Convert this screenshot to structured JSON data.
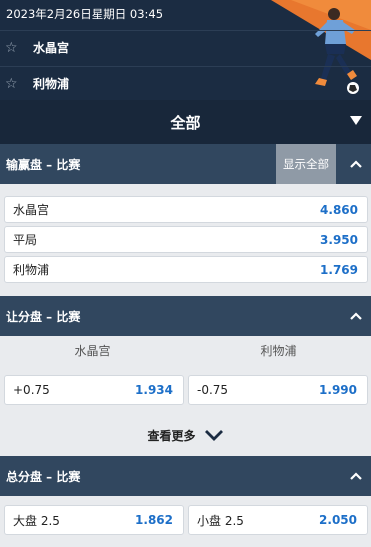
{
  "header": {
    "datetime": "2023年2月26日星期日 03:45",
    "teams": [
      {
        "name": "水晶宫",
        "star_icon": "star-outline-icon"
      },
      {
        "name": "利物浦",
        "star_icon": "star-outline-icon"
      }
    ],
    "art": "soccer-player-illustration"
  },
  "filter": {
    "label": "全部",
    "icon": "caret-down-icon"
  },
  "moneyline": {
    "title": "输赢盘 – 比赛",
    "show_all": "显示全部",
    "rows": [
      {
        "label": "水晶宫",
        "odds": "4.860"
      },
      {
        "label": "平局",
        "odds": "3.950"
      },
      {
        "label": "利物浦",
        "odds": "1.769"
      }
    ]
  },
  "handicap": {
    "title": "让分盘 – 比赛",
    "columns": [
      "水晶宫",
      "利物浦"
    ],
    "cells": [
      {
        "label": "+0.75",
        "odds": "1.934"
      },
      {
        "label": "-0.75",
        "odds": "1.990"
      }
    ],
    "more": "查看更多"
  },
  "totals": {
    "title": "总分盘 – 比赛",
    "cells": [
      {
        "label": "大盘 2.5",
        "odds": "1.862"
      },
      {
        "label": "小盘 2.5",
        "odds": "2.050"
      }
    ]
  },
  "colors": {
    "header_bg": "#1b2c42",
    "section_bg": "#31475f",
    "odds_blue": "#1d6fc8",
    "accent_orange": "#e8772e"
  }
}
